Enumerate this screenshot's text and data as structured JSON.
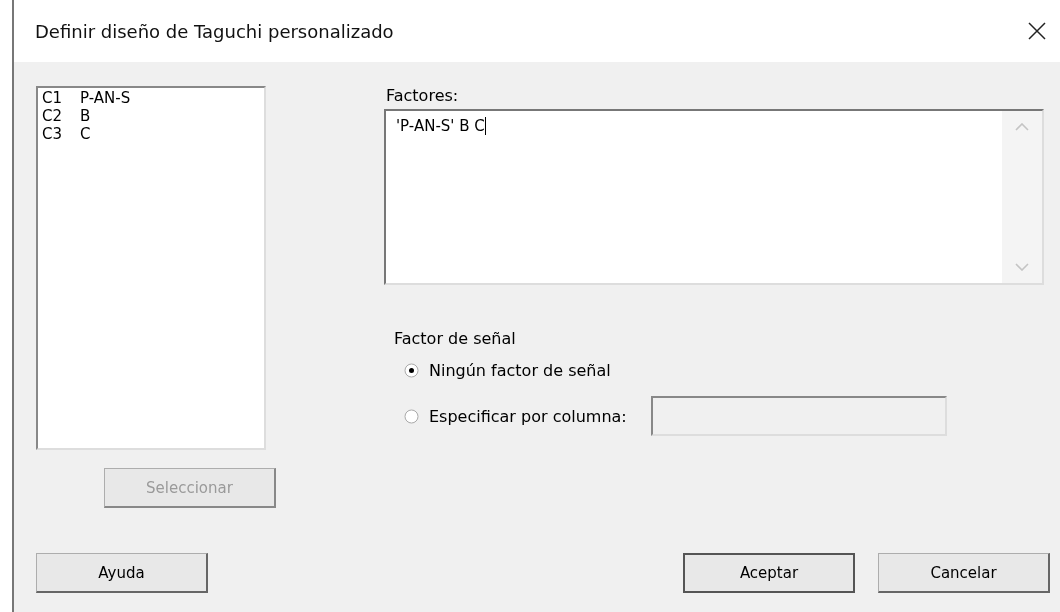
{
  "window": {
    "title": "Definir diseño de Taguchi personalizado"
  },
  "columns": [
    {
      "column": "C1",
      "name": "P-AN-S"
    },
    {
      "column": "C2",
      "name": "B"
    },
    {
      "column": "C3",
      "name": "C"
    }
  ],
  "select_button": {
    "label": "Seleccionar",
    "disabled": true
  },
  "factors": {
    "label": "Factores:",
    "value": "'P-AN-S' B C"
  },
  "signal": {
    "label": "Factor de señal",
    "options": [
      {
        "label": "Ningún factor de señal",
        "selected": true
      },
      {
        "label": "Especificar por columna:",
        "selected": false
      }
    ]
  },
  "buttons": [
    {
      "label": "Ayuda",
      "default": false
    },
    {
      "label": "Aceptar",
      "default": true
    },
    {
      "label": "Cancelar",
      "default": false
    }
  ]
}
